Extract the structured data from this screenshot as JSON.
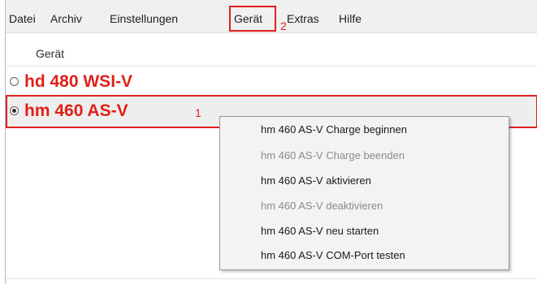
{
  "menubar": {
    "items": [
      "Datei",
      "Archiv",
      "Einstellungen",
      "Gerät",
      "Extras",
      "Hilfe"
    ],
    "highlight_marker": "2"
  },
  "list": {
    "header": "Gerät",
    "rows": [
      {
        "name": "hd 480 WSI-V",
        "selected": false
      },
      {
        "name": "hm 460 AS-V",
        "selected": true,
        "marker": "1"
      }
    ]
  },
  "context_menu": {
    "items": [
      {
        "label": "hm 460 AS-V Charge beginnen",
        "enabled": true
      },
      {
        "label": "hm 460 AS-V Charge beenden",
        "enabled": false
      },
      {
        "label": "hm 460 AS-V aktivieren",
        "enabled": true
      },
      {
        "label": "hm 460 AS-V deaktivieren",
        "enabled": false
      },
      {
        "label": "hm 460 AS-V neu starten",
        "enabled": true
      },
      {
        "label": "hm 460 AS-V COM-Port testen",
        "enabled": true
      }
    ]
  },
  "colors": {
    "accent_red": "#e02020",
    "menubar_bg": "#f0f0f0",
    "context_bg": "#f3f3f3"
  }
}
